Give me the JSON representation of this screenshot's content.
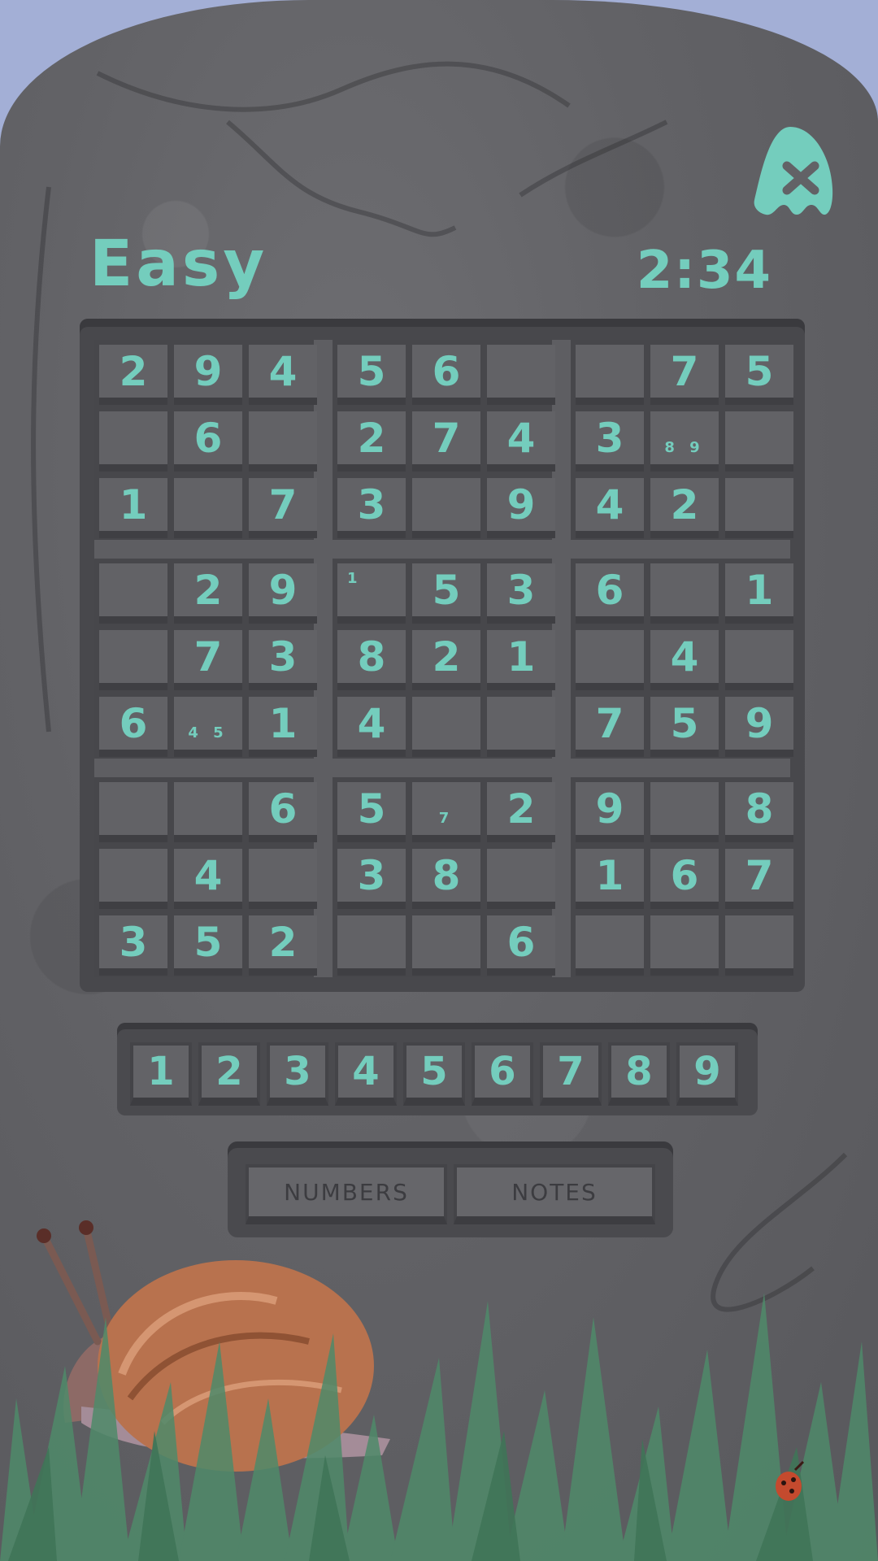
{
  "header": {
    "difficulty": "Easy",
    "timer": "2:34"
  },
  "close_button": {
    "icon": "ghost-close-icon"
  },
  "board": {
    "rows": [
      [
        "2",
        "9",
        "4",
        "5",
        "6",
        "",
        "",
        "7",
        "5"
      ],
      [
        "",
        "6",
        "",
        "2",
        "7",
        "4",
        "3",
        "",
        ""
      ],
      [
        "1",
        "",
        "7",
        "3",
        "",
        "9",
        "4",
        "2",
        ""
      ],
      [
        "",
        "2",
        "9",
        "",
        "5",
        "3",
        "6",
        "",
        "1"
      ],
      [
        "",
        "7",
        "3",
        "8",
        "2",
        "1",
        "",
        "4",
        ""
      ],
      [
        "6",
        "",
        "1",
        "4",
        "",
        "",
        "7",
        "5",
        "9"
      ],
      [
        "",
        "",
        "6",
        "5",
        "",
        "2",
        "9",
        "",
        "8"
      ],
      [
        "",
        "4",
        "",
        "3",
        "8",
        "",
        "1",
        "6",
        "7"
      ],
      [
        "3",
        "5",
        "2",
        "",
        "",
        "6",
        "",
        "",
        ""
      ]
    ],
    "notes": [
      {
        "row": 1,
        "col": 7,
        "text": "8 9"
      },
      {
        "row": 3,
        "col": 3,
        "text": "1"
      },
      {
        "row": 5,
        "col": 1,
        "text": "4 5"
      },
      {
        "row": 6,
        "col": 4,
        "text": "7"
      }
    ]
  },
  "number_pad": [
    "1",
    "2",
    "3",
    "4",
    "5",
    "6",
    "7",
    "8",
    "9"
  ],
  "mode_toggle": {
    "numbers_label": "NUMBERS",
    "notes_label": "NOTES"
  },
  "colors": {
    "accent": "#74cdbd",
    "sky": "#a3afd6",
    "stone": "#626266",
    "grass": "#4f8a6a"
  }
}
